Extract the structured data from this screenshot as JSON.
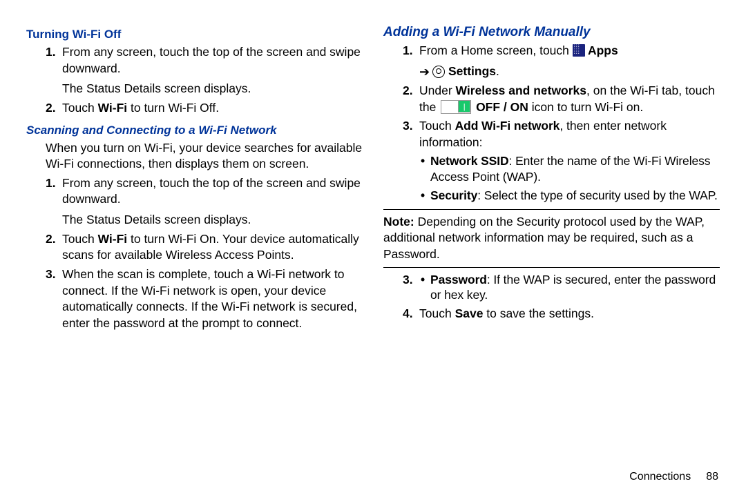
{
  "left": {
    "h1": "Turning Wi-Fi Off",
    "s1_1a": "From any screen, touch the top of the screen and swipe downward.",
    "s1_1b": "The Status Details screen displays.",
    "s1_2a": "Touch ",
    "s1_2b": "Wi-Fi",
    "s1_2c": " to turn Wi-Fi Off.",
    "h2": "Scanning and Connecting to a Wi-Fi Network",
    "intro": "When you turn on Wi-Fi, your device searches for available Wi-Fi connections, then displays them on screen.",
    "s2_1a": "From any screen, touch the top of the screen and swipe downward.",
    "s2_1b": "The Status Details screen displays.",
    "s2_2a": "Touch ",
    "s2_2b": "Wi-Fi",
    "s2_2c": " to turn Wi-Fi On. Your device automatically scans for available Wireless Access Points.",
    "s2_3": "When the scan is complete, touch a Wi-Fi network to connect. If the Wi-Fi network is open, your device automatically connects. If the Wi-Fi network is secured, enter the password at the prompt to connect."
  },
  "right": {
    "h1": "Adding a Wi-Fi Network Manually",
    "s1a": "From a Home screen, touch ",
    "apps": " Apps",
    "arrow": "➔",
    "settings": " Settings",
    "period": ".",
    "s2a": "Under ",
    "s2b": "Wireless and networks",
    "s2c": ", on the Wi-Fi tab, touch the ",
    "s2d": " OFF / ON",
    "s2e": " icon to turn Wi-Fi on.",
    "s3a": "Touch ",
    "s3b": "Add Wi-Fi network",
    "s3c": ", then enter network information:",
    "b1a": "Network SSID",
    "b1b": ": Enter the name of the Wi-Fi Wireless Access Point (WAP).",
    "b2a": "Security",
    "b2b": ": Select the type of security used by the WAP.",
    "note_lbl": "Note:",
    "note": " Depending on the Security protocol used by the WAP, additional network information may be required, such as a Password.",
    "b3a": "Password",
    "b3b": ": If the WAP is secured, enter the password or hex key.",
    "s4a": "Touch ",
    "s4b": "Save",
    "s4c": " to save the settings."
  },
  "footer": {
    "section": "Connections",
    "page": "88"
  }
}
